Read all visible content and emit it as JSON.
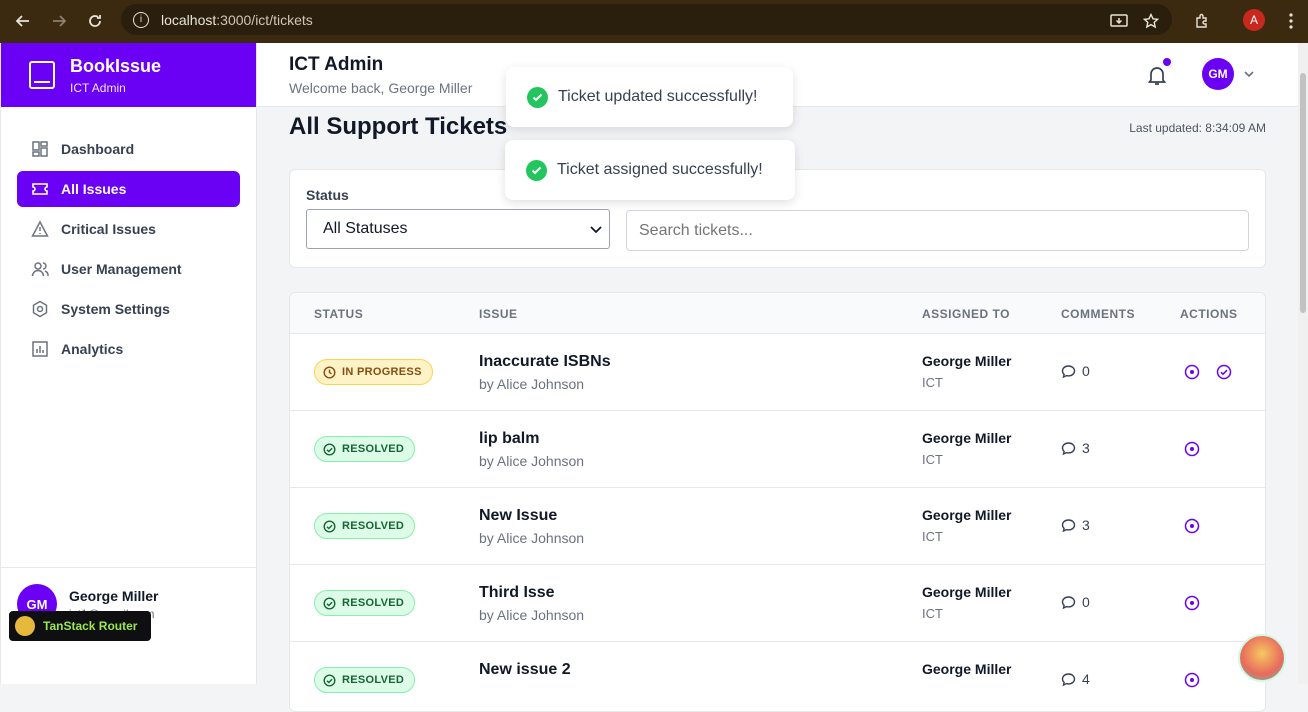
{
  "browser": {
    "url_host": "localhost",
    "url_rest": ":3000/ict/tickets",
    "profile_initial": "A"
  },
  "brand": {
    "name": "BookIssue",
    "role": "ICT Admin"
  },
  "sidebar": {
    "items": [
      {
        "label": "Dashboard",
        "icon": "dashboard-icon"
      },
      {
        "label": "All Issues",
        "icon": "ticket-icon",
        "active": true
      },
      {
        "label": "Critical Issues",
        "icon": "warning-icon"
      },
      {
        "label": "User Management",
        "icon": "users-icon"
      },
      {
        "label": "System Settings",
        "icon": "settings-icon"
      },
      {
        "label": "Analytics",
        "icon": "analytics-icon"
      }
    ],
    "user": {
      "initials": "GM",
      "name": "George Miller",
      "email": "ict1@gmail.com"
    }
  },
  "tanstack": {
    "label": "TanStack Router"
  },
  "header": {
    "title": "ICT Admin",
    "subtitle": "Welcome back, George Miller",
    "avatar_initials": "GM"
  },
  "page": {
    "title": "All Support Tickets",
    "last_updated": "Last updated: 8:34:09 AM"
  },
  "filters": {
    "status_label": "Status",
    "status_value": "All Statuses",
    "search_placeholder": "Search tickets..."
  },
  "table": {
    "headers": {
      "status": "STATUS",
      "issue": "ISSUE",
      "assigned": "ASSIGNED TO",
      "comments": "COMMENTS",
      "actions": "ACTIONS"
    },
    "rows": [
      {
        "status": "IN PROGRESS",
        "type": "prog",
        "title": "Inaccurate ISBNs",
        "by": "by Alice Johnson",
        "assignee": "George Miller",
        "dept": "ICT",
        "comments": "0",
        "can_assign": true
      },
      {
        "status": "RESOLVED",
        "type": "res",
        "title": "lip balm",
        "by": "by Alice Johnson",
        "assignee": "George Miller",
        "dept": "ICT",
        "comments": "3",
        "can_assign": false
      },
      {
        "status": "RESOLVED",
        "type": "res",
        "title": "New Issue",
        "by": "by Alice Johnson",
        "assignee": "George Miller",
        "dept": "ICT",
        "comments": "3",
        "can_assign": false
      },
      {
        "status": "RESOLVED",
        "type": "res",
        "title": "Third Isse",
        "by": "by Alice Johnson",
        "assignee": "George Miller",
        "dept": "ICT",
        "comments": "0",
        "can_assign": false
      },
      {
        "status": "RESOLVED",
        "type": "res",
        "title": "New issue 2",
        "by": "",
        "assignee": "George Miller",
        "dept": "",
        "comments": "4",
        "can_assign": false
      }
    ]
  },
  "toasts": [
    {
      "message": "Ticket updated successfully!"
    },
    {
      "message": "Ticket assigned successfully!"
    }
  ],
  "colors": {
    "accent": "#6a00f4",
    "success": "#22c55e",
    "progress_bg": "#fef3c7",
    "resolved_bg": "#dcfce7"
  }
}
